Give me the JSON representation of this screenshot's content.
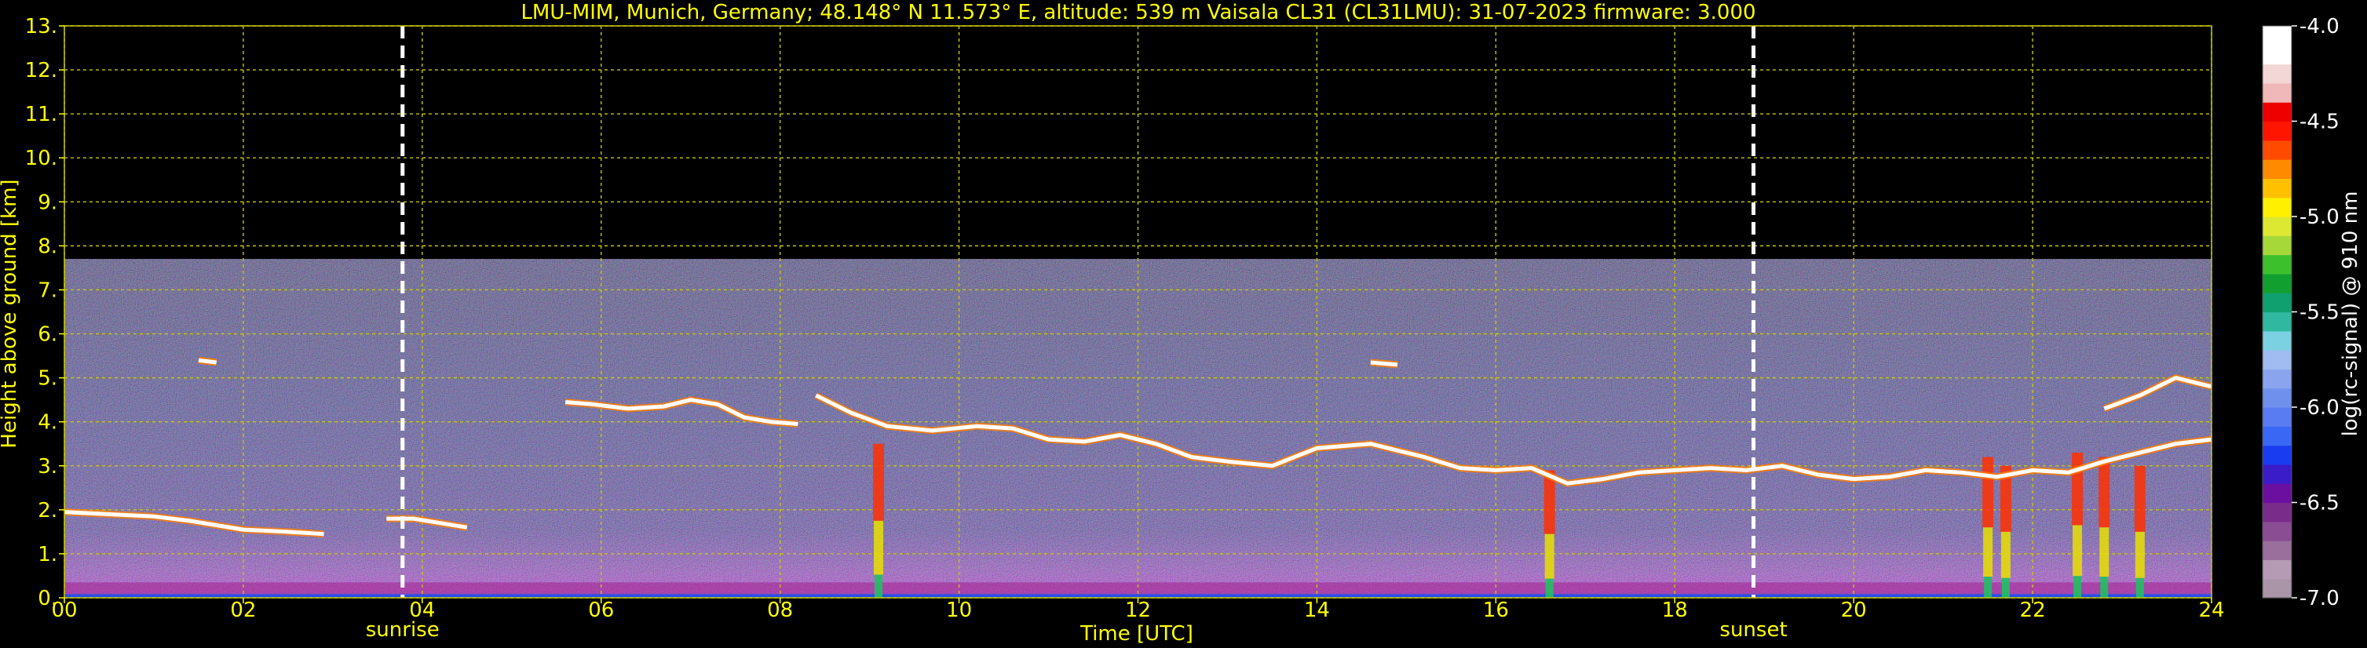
{
  "chart_data": {
    "type": "heatmap",
    "title": "LMU-MIM, Munich, Germany; 48.148° N 11.573° E, altitude: 539 m    Vaisala CL31 (CL31LMU): 31-07-2023    firmware: 3.000",
    "xlabel": "Time [UTC]",
    "ylabel": "Height above ground [km]",
    "xlim": [
      0,
      24
    ],
    "ylim": [
      0,
      13
    ],
    "x_ticks": [
      {
        "v": 0,
        "label": "00"
      },
      {
        "v": 2,
        "label": "02"
      },
      {
        "v": 4,
        "label": "04"
      },
      {
        "v": 6,
        "label": "06"
      },
      {
        "v": 8,
        "label": "08"
      },
      {
        "v": 10,
        "label": "10"
      },
      {
        "v": 12,
        "label": "12"
      },
      {
        "v": 14,
        "label": "14"
      },
      {
        "v": 16,
        "label": "16"
      },
      {
        "v": 18,
        "label": "18"
      },
      {
        "v": 20,
        "label": "20"
      },
      {
        "v": 22,
        "label": "22"
      },
      {
        "v": 24,
        "label": "24"
      }
    ],
    "y_ticks": [
      {
        "v": 0,
        "label": "0."
      },
      {
        "v": 1,
        "label": "1."
      },
      {
        "v": 2,
        "label": "2."
      },
      {
        "v": 3,
        "label": "3."
      },
      {
        "v": 4,
        "label": "4."
      },
      {
        "v": 5,
        "label": "5."
      },
      {
        "v": 6,
        "label": "6."
      },
      {
        "v": 7,
        "label": "7."
      },
      {
        "v": 8,
        "label": "8."
      },
      {
        "v": 9,
        "label": "9."
      },
      {
        "v": 10,
        "label": "10."
      },
      {
        "v": 11,
        "label": "11."
      },
      {
        "v": 12,
        "label": "12."
      },
      {
        "v": 13,
        "label": "13."
      }
    ],
    "grid": true,
    "data_max_height_km": 7.7,
    "annotations": [
      {
        "label": "sunrise",
        "x": 3.78
      },
      {
        "label": "sunset",
        "x": 18.88
      }
    ],
    "cloud_base_layers": [
      {
        "points": [
          [
            0.0,
            1.95
          ],
          [
            0.5,
            1.9
          ],
          [
            1.0,
            1.85
          ],
          [
            1.4,
            1.75
          ],
          [
            1.7,
            1.65
          ],
          [
            2.0,
            1.55
          ],
          [
            2.5,
            1.5
          ],
          [
            2.9,
            1.45
          ]
        ]
      },
      {
        "points": [
          [
            3.6,
            1.8
          ],
          [
            3.9,
            1.8
          ],
          [
            4.2,
            1.7
          ],
          [
            4.5,
            1.6
          ]
        ]
      },
      {
        "points": [
          [
            1.5,
            5.4
          ],
          [
            1.7,
            5.35
          ]
        ]
      },
      {
        "points": [
          [
            5.6,
            4.45
          ],
          [
            5.9,
            4.4
          ],
          [
            6.3,
            4.3
          ],
          [
            6.7,
            4.35
          ],
          [
            7.0,
            4.5
          ],
          [
            7.3,
            4.4
          ],
          [
            7.6,
            4.1
          ],
          [
            7.9,
            4.0
          ],
          [
            8.2,
            3.95
          ]
        ]
      },
      {
        "points": [
          [
            8.4,
            4.6
          ],
          [
            8.8,
            4.2
          ],
          [
            9.2,
            3.9
          ],
          [
            9.7,
            3.8
          ],
          [
            10.2,
            3.9
          ],
          [
            10.6,
            3.85
          ],
          [
            11.0,
            3.6
          ],
          [
            11.4,
            3.55
          ],
          [
            11.8,
            3.7
          ],
          [
            12.2,
            3.5
          ],
          [
            12.6,
            3.2
          ],
          [
            13.0,
            3.1
          ],
          [
            13.5,
            3.0
          ],
          [
            14.0,
            3.4
          ],
          [
            14.6,
            3.5
          ],
          [
            15.2,
            3.2
          ],
          [
            15.6,
            2.95
          ],
          [
            16.0,
            2.9
          ],
          [
            16.4,
            2.95
          ],
          [
            16.8,
            2.6
          ],
          [
            17.2,
            2.7
          ],
          [
            17.6,
            2.85
          ],
          [
            18.0,
            2.9
          ],
          [
            18.4,
            2.95
          ],
          [
            18.8,
            2.9
          ],
          [
            19.2,
            3.0
          ],
          [
            19.6,
            2.8
          ],
          [
            20.0,
            2.7
          ],
          [
            20.4,
            2.75
          ],
          [
            20.8,
            2.9
          ],
          [
            21.2,
            2.85
          ],
          [
            21.6,
            2.75
          ],
          [
            22.0,
            2.9
          ],
          [
            22.4,
            2.85
          ],
          [
            22.8,
            3.1
          ],
          [
            23.2,
            3.3
          ],
          [
            23.6,
            3.5
          ],
          [
            24.0,
            3.6
          ]
        ]
      },
      {
        "points": [
          [
            14.6,
            5.35
          ],
          [
            14.9,
            5.3
          ]
        ]
      },
      {
        "points": [
          [
            22.8,
            4.3
          ],
          [
            23.2,
            4.6
          ],
          [
            23.6,
            5.0
          ],
          [
            24.0,
            4.8
          ]
        ]
      }
    ],
    "precip_streaks": [
      {
        "x": 9.1,
        "top": 3.5
      },
      {
        "x": 16.6,
        "top": 2.9
      },
      {
        "x": 21.5,
        "top": 3.2
      },
      {
        "x": 21.7,
        "top": 3.0
      },
      {
        "x": 22.5,
        "top": 3.3
      },
      {
        "x": 22.8,
        "top": 3.2
      },
      {
        "x": 23.2,
        "top": 3.0
      }
    ]
  },
  "colorbar": {
    "label": "log(rc-signal) @ 910 nm",
    "range": [
      -7.0,
      -4.0
    ],
    "ticks": [
      {
        "v": -4.0,
        "label": "-4.0"
      },
      {
        "v": -4.5,
        "label": "-4.5"
      },
      {
        "v": -5.0,
        "label": "-5.0"
      },
      {
        "v": -5.5,
        "label": "-5.5"
      },
      {
        "v": -6.0,
        "label": "-6.0"
      },
      {
        "v": -6.5,
        "label": "-6.5"
      },
      {
        "v": -7.0,
        "label": "-7.0"
      }
    ],
    "colors": [
      "#a994a8",
      "#b59bb4",
      "#9a6f9c",
      "#8a4d94",
      "#7a2c8a",
      "#6a0fa0",
      "#3a1cc8",
      "#1a3cf0",
      "#3a68f5",
      "#5a7cf2",
      "#7090ee",
      "#8aa4ee",
      "#a0bcf0",
      "#7bd1e2",
      "#30b8a0",
      "#10a070",
      "#11a030",
      "#3cc02c",
      "#a6d83a",
      "#dce832",
      "#fff000",
      "#ffc000",
      "#ff8a00",
      "#ff4a00",
      "#ff1500",
      "#ee0000",
      "#f0b8b8",
      "#f3d6d6",
      "#ffffff",
      "#ffffff"
    ]
  }
}
